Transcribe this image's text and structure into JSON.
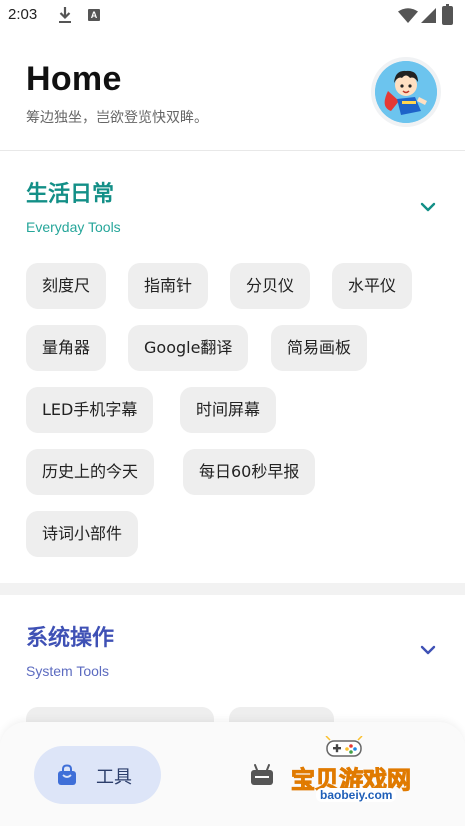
{
  "status_bar": {
    "time": "2:03",
    "notification_icons": [
      "download-icon",
      "a-badge-icon"
    ],
    "system_icons": [
      "wifi-icon",
      "signal-icon",
      "battery-icon"
    ],
    "a_badge": "A"
  },
  "header": {
    "title": "Home",
    "subtitle": "筹边独坐，岂欲登览快双眸。",
    "avatar_icon": "cartoon-superhero-avatar"
  },
  "sections": [
    {
      "title": "生活日常",
      "subtitle": "Everyday Tools",
      "title_color": "#138f87",
      "subtitle_color": "#26a69a",
      "chips": [
        "刻度尺",
        "指南针",
        "分贝仪",
        "水平仪",
        "量角器",
        "Google翻译",
        "简易画板",
        "LED手机字幕",
        "时间屏幕",
        "历史上的今天",
        "每日60秒早报",
        "诗词小部件"
      ]
    },
    {
      "title": "系统操作",
      "subtitle": "System Tools",
      "title_color": "#3f51b5",
      "subtitle_color": "#5c6bc0",
      "chips": []
    }
  ],
  "bottom_nav": {
    "items": [
      {
        "label": "工具",
        "icon": "shopping-bag-icon",
        "active": true
      },
      {
        "label": "",
        "icon": "robot-icon",
        "active": false
      }
    ],
    "active_bg": "#dde5f8"
  },
  "watermark": {
    "text": "宝贝游戏网",
    "domain": "baobeiy.com"
  }
}
